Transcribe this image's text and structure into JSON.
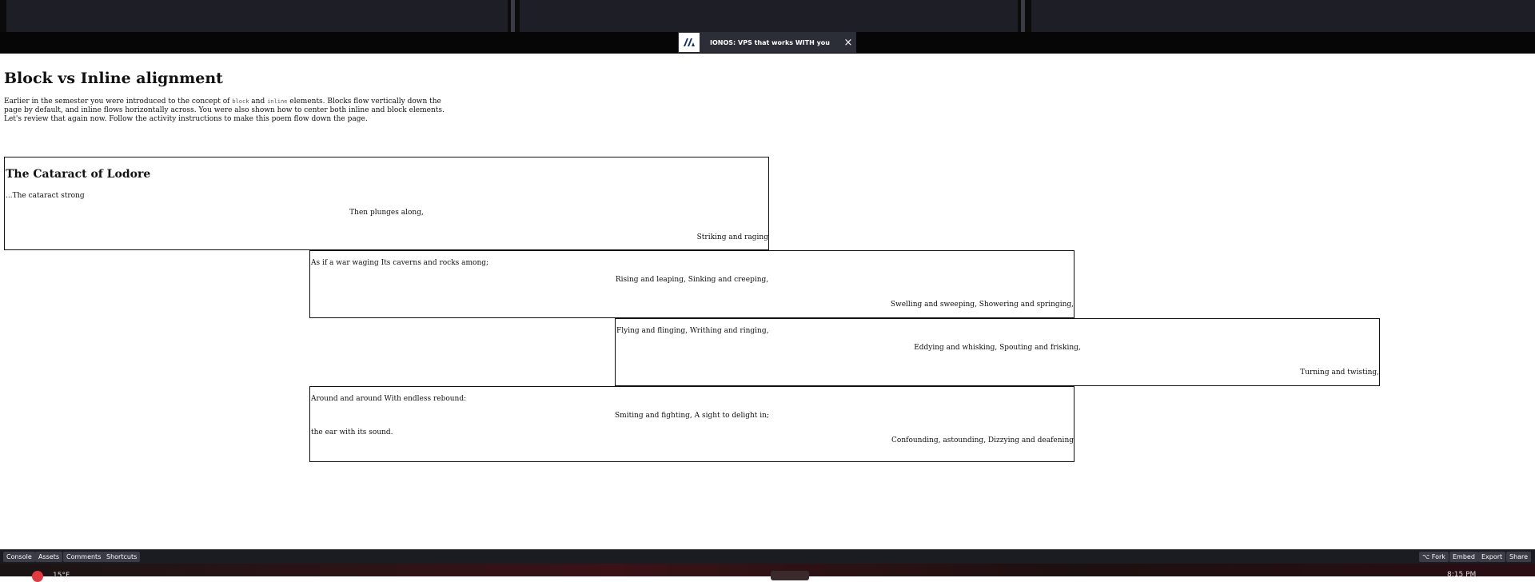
{
  "ad": {
    "logo_text": "IONOS",
    "text": "IONOS: VPS that works WITH you",
    "close_glyph": "×"
  },
  "preview": {
    "title": "Block vs Inline alignment",
    "intro": {
      "part1": "Earlier in the semester you were introduced to the concept of ",
      "code_block": "block",
      "part2": " and ",
      "code_inline": "inline",
      "part3": " elements. Blocks flow vertically down the page by default, and inline flows horizontally across. You were also shown how to center both inline and block elements. Let's review that again now. Follow the activity instructions to make this poem flow down the page."
    },
    "poem": {
      "title": "The Cataract of Lodore",
      "boxes": [
        {
          "lines": [
            "...The cataract strong",
            "Then plunges along,",
            "Striking and raging"
          ]
        },
        {
          "lines": [
            "As if a war waging Its caverns and rocks among;",
            "Rising and leaping, Sinking and creeping,",
            "Swelling and sweeping, Showering and springing,"
          ]
        },
        {
          "lines": [
            "Flying and flinging, Writhing and ringing,",
            "Eddying and whisking, Spouting and frisking,",
            "Turning and twisting,"
          ]
        },
        {
          "lines": [
            "Around and around With endless rebound:",
            "Smiting and fighting, A sight to delight in;",
            "the ear with its sound.",
            "Confounding, astounding, Dizzying and deafening"
          ]
        }
      ]
    }
  },
  "bottombar": {
    "left": [
      "Console",
      "Assets",
      "Comments",
      "Shortcuts"
    ],
    "right": [
      "⌥ Fork",
      "Embed",
      "Export",
      "Share"
    ]
  },
  "taskbar": {
    "temp": "15°F",
    "clock": "8:15 PM"
  }
}
